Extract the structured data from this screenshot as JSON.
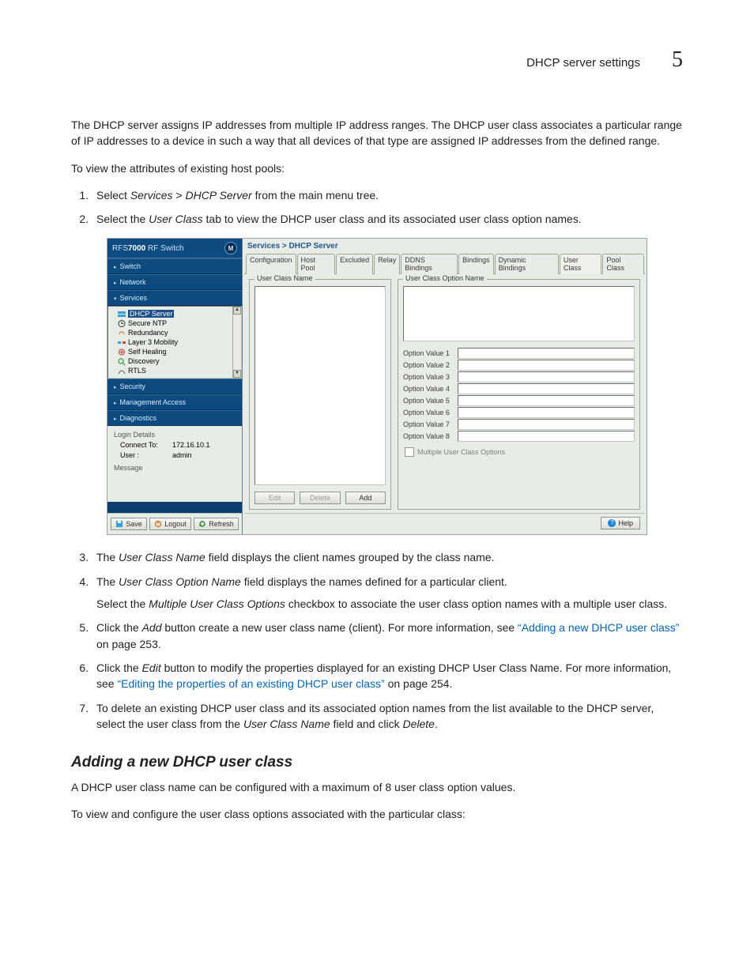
{
  "header": {
    "title": "DHCP server settings",
    "chapter": "5"
  },
  "intro": "The DHCP server assigns IP addresses from multiple IP address ranges. The DHCP user class associates a particular range of IP addresses to a device in such a way that all devices of that type are assigned IP addresses from the defined range.",
  "lead": "To view the attributes of existing host pools:",
  "steps1": {
    "s1_a": "Select ",
    "s1_b": "Services",
    "s1_c": " > ",
    "s1_d": "DHCP Server",
    "s1_e": " from the main menu tree.",
    "s2_a": "Select the ",
    "s2_b": "User Class",
    "s2_c": " tab to view the DHCP user class and its associated user class option names."
  },
  "screenshot": {
    "product_a": "RFS",
    "product_b": "7000",
    "product_c": " RF Switch",
    "logo": "M",
    "nav": {
      "switch": "Switch",
      "network": "Network",
      "services": "Services",
      "security": "Security",
      "mgmt": "Management Access",
      "diag": "Diagnostics"
    },
    "tree": {
      "dhcp": "DHCP Server",
      "ntp": "Secure NTP",
      "redundancy": "Redundancy",
      "l3": "Layer 3 Mobility",
      "selfheal": "Self Healing",
      "discovery": "Discovery",
      "rtls": "RTLS"
    },
    "login": {
      "title": "Login Details",
      "connect_lbl": "Connect To:",
      "connect_val": "172.16.10.1",
      "user_lbl": "User :",
      "user_val": "admin",
      "msg_title": "Message"
    },
    "sb_buttons": {
      "save": "Save",
      "logout": "Logout",
      "refresh": "Refresh"
    },
    "breadcrumb": "Services > DHCP Server",
    "tabs": {
      "t0": "Configuration",
      "t1": "Host Pool",
      "t2": "Excluded",
      "t3": "Relay",
      "t4": "DDNS Bindings",
      "t5": "Bindings",
      "t6": "Dynamic Bindings",
      "t7": "User Class",
      "t8": "Pool Class"
    },
    "ucn_legend": "User Class Name",
    "ucon_legend": "User Class Option Name",
    "opts": {
      "o1": "Option Value 1",
      "o2": "Option Value 2",
      "o3": "Option Value 3",
      "o4": "Option Value 4",
      "o5": "Option Value 5",
      "o6": "Option Value 6",
      "o7": "Option Value 7",
      "o8": "Option Value 8"
    },
    "multi_chk": "Multiple User Class Options",
    "btns": {
      "edit": "Edit",
      "delete": "Delete",
      "add": "Add"
    },
    "help": "Help"
  },
  "steps2": {
    "s3_a": "The ",
    "s3_b": "User Class Name",
    "s3_c": " field displays the client names grouped by the class name.",
    "s4_a": "The ",
    "s4_b": "User Class Option Name",
    "s4_c": " field displays the names defined for a particular client.",
    "s4p_a": "Select the ",
    "s4p_b": "Multiple User Class Options",
    "s4p_c": " checkbox to associate the user class option names with a multiple user class.",
    "s5_a": "Click the ",
    "s5_b": "Add",
    "s5_c": " button create a new user class name (client). For more information, see ",
    "s5_link": "“Adding a new DHCP user class”",
    "s5_d": " on page 253.",
    "s6_a": "Click the ",
    "s6_b": "Edit",
    "s6_c": " button to modify the properties displayed for an existing DHCP User Class Name. For more information, see ",
    "s6_link": "“Editing the properties of an existing DHCP user class”",
    "s6_d": " on page 254.",
    "s7_a": "To delete an existing DHCP user class and its associated option names from the list available to the DHCP server, select the user class from the ",
    "s7_b": "User Class Name",
    "s7_c": " field and click ",
    "s7_d": "Delete",
    "s7_e": "."
  },
  "section": {
    "title": "Adding a new DHCP user class",
    "p1": "A DHCP user class name can be configured with a maximum of 8 user class option values.",
    "p2": "To view and configure the user class options associated with the particular class:"
  }
}
